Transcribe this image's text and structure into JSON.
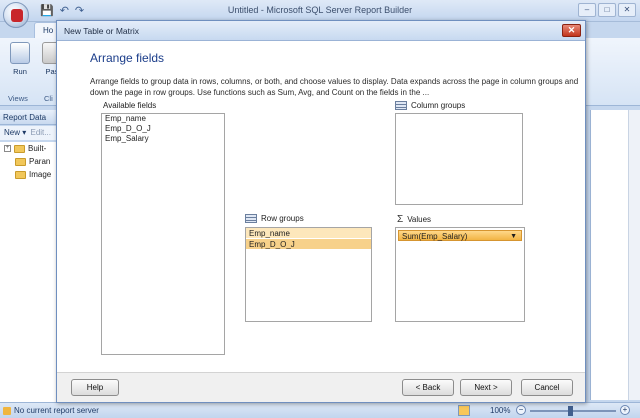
{
  "app": {
    "title": "Untitled - Microsoft SQL Server Report Builder",
    "tabs": [
      "Ho",
      "I"
    ],
    "ribbon": {
      "run_label": "Run",
      "paste_label": "Pas",
      "group_views": "Views",
      "group_clip": "Cli"
    },
    "report_data": {
      "header": "Report Data",
      "new_label": "New ▾",
      "edit_label": "Edit...",
      "tree": [
        {
          "label": "Built-"
        },
        {
          "label": "Paran"
        },
        {
          "label": "Image"
        }
      ]
    },
    "status": {
      "text": "No current report server",
      "zoom": "100%",
      "minus": "−",
      "plus": "+"
    },
    "window_buttons": [
      "–",
      "□",
      "✕"
    ]
  },
  "dialog": {
    "title": "New Table or Matrix",
    "close": "✕",
    "heading": "Arrange fields",
    "description": "Arrange fields to group data in rows, columns, or both, and choose values to display. Data expands across the page in column groups and down the page in row groups.  Use functions such as Sum, Avg, and Count on the fields in the ...",
    "available_fields": {
      "label": "Available fields",
      "items": [
        "Emp_name",
        "Emp_D_O_J",
        "Emp_Salary"
      ]
    },
    "column_groups": {
      "label": "Column groups",
      "items": []
    },
    "row_groups": {
      "label": "Row groups",
      "items": [
        "Emp_name",
        "Emp_D_O_J"
      ]
    },
    "values": {
      "label": "Values",
      "symbol": "Σ",
      "items": [
        "Sum(Emp_Salary)"
      ]
    },
    "buttons": {
      "help": "Help",
      "back": "< Back",
      "next": "Next >",
      "cancel": "Cancel"
    }
  }
}
